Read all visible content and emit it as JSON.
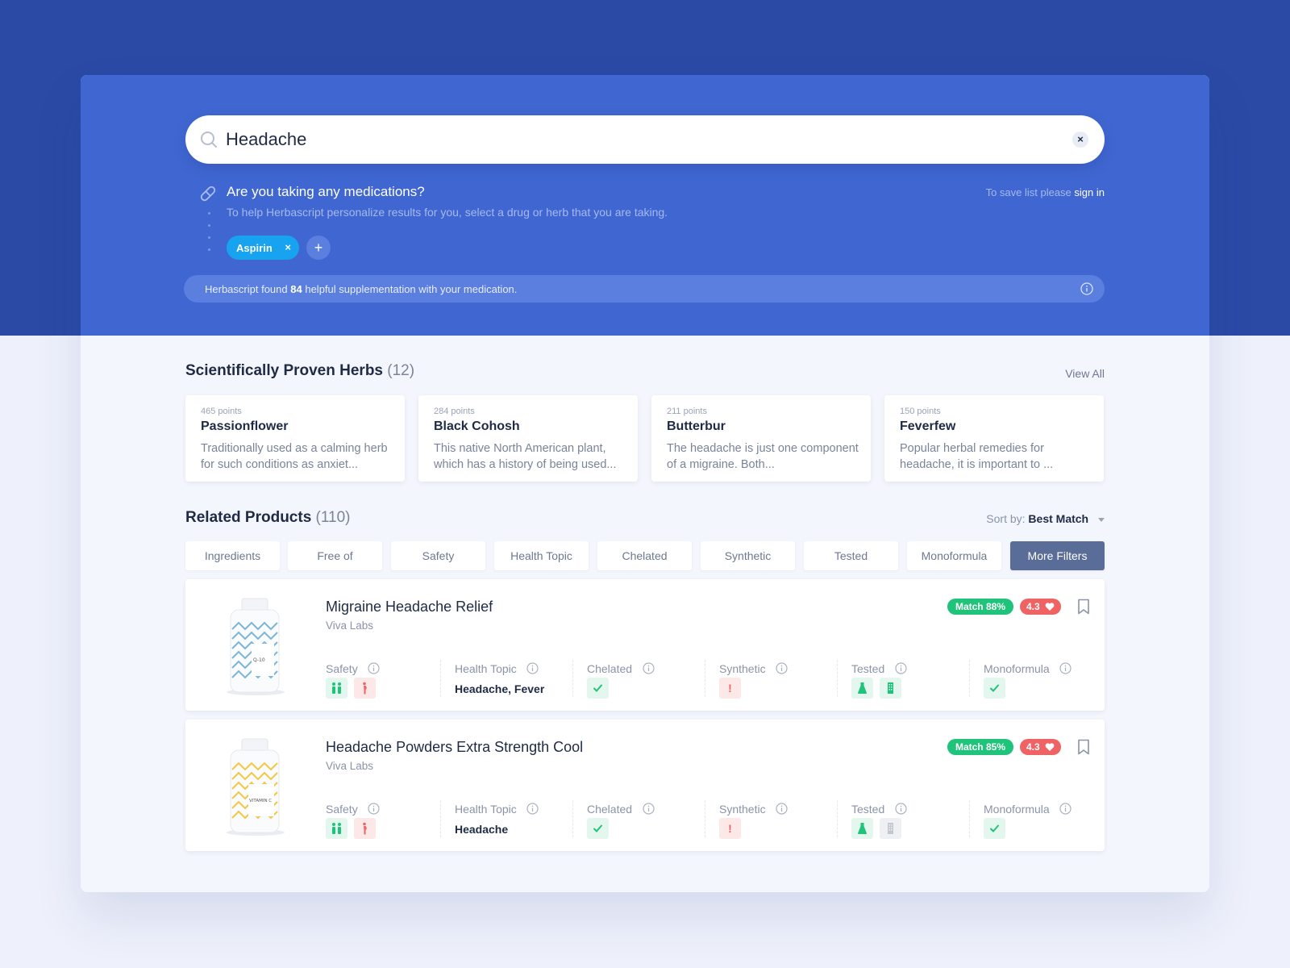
{
  "search": {
    "query": "Headache",
    "clear_label": "×"
  },
  "medications": {
    "question": "Are you taking any medications?",
    "help_text": "To help Herbascript personalize results for you, select a drug or herb that you are taking.",
    "save_prefix": "To save list please",
    "sign_in_label": "sign in",
    "chips": [
      {
        "label": "Aspirin",
        "remove": "×"
      }
    ],
    "add_label": "+"
  },
  "found_bar": {
    "prefix": "Herbascript found",
    "count": "84",
    "suffix": "helpful supplementation with your medication."
  },
  "herbs_section": {
    "title": "Scientifically Proven Herbs",
    "count": "(12)",
    "view_all": "View All",
    "cards": [
      {
        "points": "465 points",
        "name": "Passionflower",
        "desc": "Traditionally used as a calming herb for such conditions as anxiet..."
      },
      {
        "points": "284 points",
        "name": "Black Cohosh",
        "desc": "This native North American plant, which has a history of being used..."
      },
      {
        "points": "211 points",
        "name": "Butterbur",
        "desc": "The headache is just one component of a migraine. Both..."
      },
      {
        "points": "150 points",
        "name": "Feverfew",
        "desc": "Popular herbal remedies for headache, it is important to ..."
      }
    ]
  },
  "products_section": {
    "title": "Related Products",
    "count": "(110)",
    "sort_label": "Sort by:",
    "sort_value": "Best Match",
    "filters": [
      "Ingredients",
      "Free of",
      "Safety",
      "Health Topic",
      "Chelated",
      "Synthetic",
      "Tested",
      "Monoformula",
      "More Filters"
    ]
  },
  "attribute_labels": {
    "safety": "Safety",
    "health_topic": "Health Topic",
    "chelated": "Chelated",
    "synthetic": "Synthetic",
    "tested": "Tested",
    "monoformula": "Monoformula"
  },
  "products": [
    {
      "name": "Migraine Headache Relief",
      "brand": "Viva Labs",
      "match": "Match 88%",
      "rating": "4.3",
      "health_topic": "Headache, Fever",
      "bottle_label": "Q-10",
      "bottle_color": "#5aa6c9",
      "tested_second_tile": "green",
      "synthetic_glyph": "!"
    },
    {
      "name": "Headache Powders Extra Strength Cool",
      "brand": "Viva Labs",
      "match": "Match 85%",
      "rating": "4.3",
      "health_topic": "Headache",
      "bottle_label": "VITAMIN C",
      "bottle_color": "#f2c230",
      "tested_second_tile": "gray",
      "synthetic_glyph": "!"
    }
  ],
  "colors": {
    "band": "#2a4aa6",
    "hero": "#4067d1",
    "chip": "#17a3f0",
    "match": "#1fc47a",
    "rating": "#f06364",
    "primary_filter": "#5a6c98"
  }
}
